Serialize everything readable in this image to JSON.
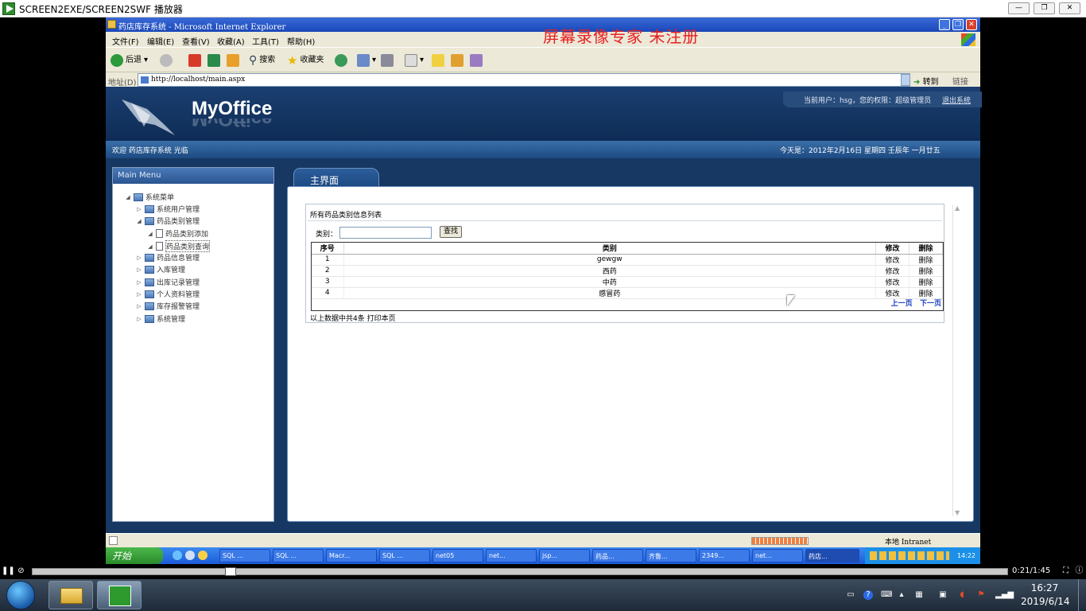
{
  "player": {
    "title": "SCREEN2EXE/SCREEN2SWF 播放器",
    "time": "0:21/1:45"
  },
  "ie": {
    "title": "药店库存系统 - Microsoft Internet Explorer",
    "watermark": "屏幕录像专家  未注册",
    "menu": [
      "文件(F)",
      "编辑(E)",
      "查看(V)",
      "收藏(A)",
      "工具(T)",
      "帮助(H)"
    ],
    "toolbar": {
      "back": "后退",
      "search": "搜索",
      "favorites": "收藏夹"
    },
    "address_label": "地址(D)",
    "address": "http://localhost/main.aspx",
    "go": "转到",
    "links": "链接",
    "status_zone": "本地 Intranet"
  },
  "app": {
    "logo": "MyOffice",
    "user_info": "当前用户：hsg，您的权限：超级管理员",
    "logout": "退出系统",
    "welcome": "欢迎 药店库存系统 光临",
    "date": "今天是：2012年2月16日  星期四  壬辰年  一月廿五",
    "menu_title": "Main Menu",
    "tree": {
      "root": "系统菜单",
      "users": "系统用户管理",
      "category": "药品类别管理",
      "category_add": "药品类别添加",
      "category_query": "药品类别查询",
      "drug_info": "药品信息管理",
      "stock_in": "入库管理",
      "stock_out": "出库记录管理",
      "profile": "个人资料管理",
      "stock_alert": "库存报警管理",
      "system": "系统管理"
    },
    "tab": "主界面",
    "panel": {
      "title": "所有药品类别信息列表",
      "filter_label": "类别：",
      "search_button": "查找",
      "columns": [
        "序号",
        "类别",
        "修改",
        "删除"
      ],
      "rows": [
        [
          "1",
          "gewgw",
          "修改",
          "删除"
        ],
        [
          "2",
          "西药",
          "修改",
          "删除"
        ],
        [
          "3",
          "中药",
          "修改",
          "删除"
        ],
        [
          "4",
          "感冒药",
          "修改",
          "删除"
        ]
      ],
      "prev": "上一页",
      "next": "下一页",
      "footer": "以上数据中共4条  打印本页"
    }
  },
  "xp_taskbar": {
    "start": "开始",
    "items": [
      "SQL ...",
      "SQL ...",
      "Macr...",
      "SQL ...",
      "net05",
      "net...",
      "jsp...",
      "药品...",
      "齐鲁...",
      "2349...",
      "net...",
      "药店..."
    ],
    "clock": "14:22"
  },
  "win7": {
    "time": "16:27",
    "date": "2019/6/14"
  }
}
